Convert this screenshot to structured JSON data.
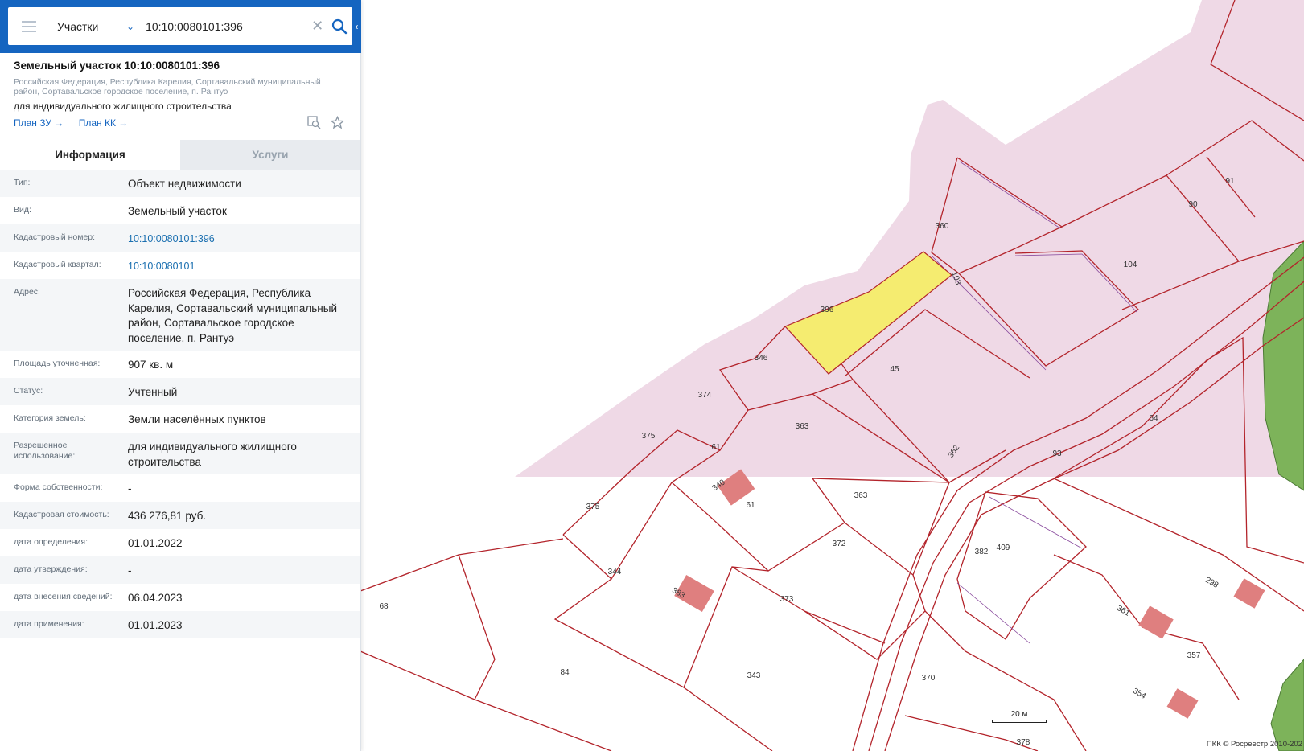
{
  "search": {
    "layer": "Участки",
    "query": "10:10:0080101:396"
  },
  "object": {
    "title": "Земельный участок 10:10:0080101:396",
    "address": "Российская Федерация, Республика Карелия, Сортавальский муниципальный район, Сортавальское городское поселение, п. Рантуэ",
    "use": "для индивидуального жилищного строительства",
    "link_plan_zu": "План ЗУ →",
    "link_plan_kk": "План КК →"
  },
  "tabs": {
    "info": "Информация",
    "services": "Услуги"
  },
  "rows": [
    {
      "label": "Тип:",
      "value": "Объект недвижимости"
    },
    {
      "label": "Вид:",
      "value": "Земельный участок"
    },
    {
      "label": "Кадастровый номер:",
      "value": "10:10:0080101:396"
    },
    {
      "label": "Кадастровый квартал:",
      "value": "10:10:0080101"
    },
    {
      "label": "Адрес:",
      "value": "Российская Федерация, Республика Карелия, Сортавальский муниципальный район, Сортавальское городское поселение, п. Рантуэ"
    },
    {
      "label": "Площадь уточненная:",
      "value": "907 кв. м"
    },
    {
      "label": "Статус:",
      "value": "Учтенный"
    },
    {
      "label": "Категория земель:",
      "value": "Земли населённых пунктов"
    },
    {
      "label": "Разрешенное использование:",
      "value": "для индивидуального жилищного строительства"
    },
    {
      "label": "Форма собственности:",
      "value": "-"
    },
    {
      "label": "Кадастровая стоимость:",
      "value": "436 276,81 руб."
    },
    {
      "label": "дата определения:",
      "value": "01.01.2022"
    },
    {
      "label": "дата утверждения:",
      "value": "-"
    },
    {
      "label": "дата внесения сведений:",
      "value": "06.04.2023"
    },
    {
      "label": "дата применения:",
      "value": "01.01.2023"
    }
  ],
  "map": {
    "parcel_labels": [
      "396",
      "346",
      "374",
      "375",
      "363",
      "61",
      "340",
      "360",
      "103",
      "104",
      "91",
      "90",
      "45",
      "362",
      "64",
      "93",
      "375",
      "61",
      "363",
      "372",
      "344",
      "383",
      "373",
      "68",
      "84",
      "343",
      "382",
      "409",
      "361",
      "298",
      "357",
      "354",
      "370",
      "378"
    ],
    "scale_label": "20 м",
    "copyright": "ПКК © Росреестр 2010-202",
    "colors": {
      "selected_fill": "#f5ec70",
      "quarter_fill": "#efd9e6",
      "boundary": "#b3242b",
      "building": "#df7f7f",
      "forest": "#7db35a",
      "accent": "#1565c0"
    }
  }
}
